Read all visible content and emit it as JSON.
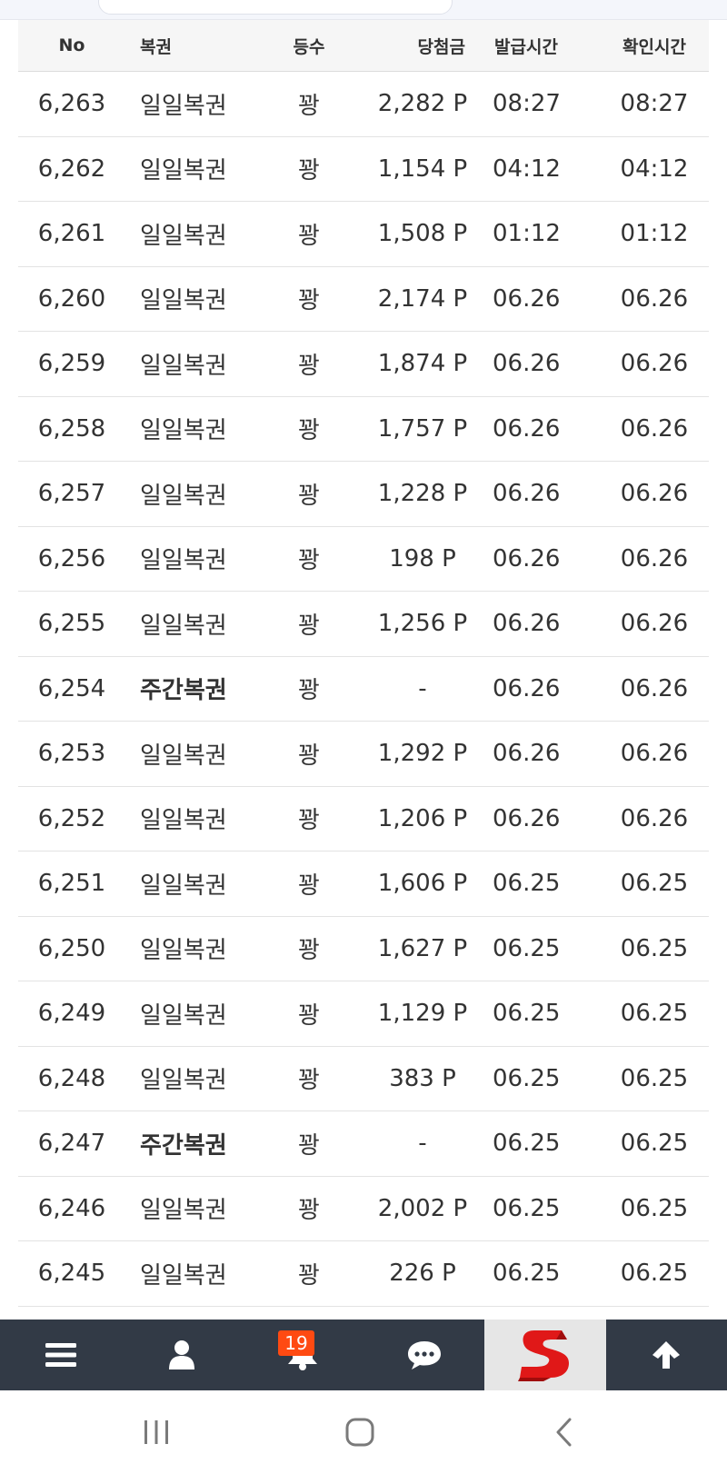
{
  "table": {
    "headers": {
      "no": "No",
      "type": "복권",
      "rank": "등수",
      "prize": "당첨금",
      "issued": "발급시간",
      "checked": "확인시간"
    },
    "rows": [
      {
        "no": "6,263",
        "type": "일일복권",
        "rank": "꽝",
        "prize": "2,282 P",
        "issued": "08:27",
        "checked": "08:27",
        "bold": false
      },
      {
        "no": "6,262",
        "type": "일일복권",
        "rank": "꽝",
        "prize": "1,154 P",
        "issued": "04:12",
        "checked": "04:12",
        "bold": false
      },
      {
        "no": "6,261",
        "type": "일일복권",
        "rank": "꽝",
        "prize": "1,508 P",
        "issued": "01:12",
        "checked": "01:12",
        "bold": false
      },
      {
        "no": "6,260",
        "type": "일일복권",
        "rank": "꽝",
        "prize": "2,174 P",
        "issued": "06.26",
        "checked": "06.26",
        "bold": false
      },
      {
        "no": "6,259",
        "type": "일일복권",
        "rank": "꽝",
        "prize": "1,874 P",
        "issued": "06.26",
        "checked": "06.26",
        "bold": false
      },
      {
        "no": "6,258",
        "type": "일일복권",
        "rank": "꽝",
        "prize": "1,757 P",
        "issued": "06.26",
        "checked": "06.26",
        "bold": false
      },
      {
        "no": "6,257",
        "type": "일일복권",
        "rank": "꽝",
        "prize": "1,228 P",
        "issued": "06.26",
        "checked": "06.26",
        "bold": false
      },
      {
        "no": "6,256",
        "type": "일일복권",
        "rank": "꽝",
        "prize": "198 P",
        "issued": "06.26",
        "checked": "06.26",
        "bold": false
      },
      {
        "no": "6,255",
        "type": "일일복권",
        "rank": "꽝",
        "prize": "1,256 P",
        "issued": "06.26",
        "checked": "06.26",
        "bold": false
      },
      {
        "no": "6,254",
        "type": "주간복권",
        "rank": "꽝",
        "prize": "-",
        "issued": "06.26",
        "checked": "06.26",
        "bold": true
      },
      {
        "no": "6,253",
        "type": "일일복권",
        "rank": "꽝",
        "prize": "1,292 P",
        "issued": "06.26",
        "checked": "06.26",
        "bold": false
      },
      {
        "no": "6,252",
        "type": "일일복권",
        "rank": "꽝",
        "prize": "1,206 P",
        "issued": "06.26",
        "checked": "06.26",
        "bold": false
      },
      {
        "no": "6,251",
        "type": "일일복권",
        "rank": "꽝",
        "prize": "1,606 P",
        "issued": "06.25",
        "checked": "06.25",
        "bold": false
      },
      {
        "no": "6,250",
        "type": "일일복권",
        "rank": "꽝",
        "prize": "1,627 P",
        "issued": "06.25",
        "checked": "06.25",
        "bold": false
      },
      {
        "no": "6,249",
        "type": "일일복권",
        "rank": "꽝",
        "prize": "1,129 P",
        "issued": "06.25",
        "checked": "06.25",
        "bold": false
      },
      {
        "no": "6,248",
        "type": "일일복권",
        "rank": "꽝",
        "prize": "383 P",
        "issued": "06.25",
        "checked": "06.25",
        "bold": false
      },
      {
        "no": "6,247",
        "type": "주간복권",
        "rank": "꽝",
        "prize": "-",
        "issued": "06.25",
        "checked": "06.25",
        "bold": true
      },
      {
        "no": "6,246",
        "type": "일일복권",
        "rank": "꽝",
        "prize": "2,002 P",
        "issued": "06.25",
        "checked": "06.25",
        "bold": false
      },
      {
        "no": "6,245",
        "type": "일일복권",
        "rank": "꽝",
        "prize": "226 P",
        "issued": "06.25",
        "checked": "06.25",
        "bold": false
      }
    ]
  },
  "bottom_nav": {
    "items": [
      {
        "icon": "menu-icon"
      },
      {
        "icon": "user-icon"
      },
      {
        "icon": "bell-icon"
      },
      {
        "icon": "chat-icon"
      },
      {
        "icon": "site-logo"
      },
      {
        "icon": "arrow-up-icon"
      }
    ],
    "notification_count": "19",
    "colors": {
      "bar": "#323a46",
      "badge": "#ff4a12",
      "logo_red": "#e01818"
    }
  },
  "system_nav": {
    "items": [
      {
        "icon": "recent-apps-icon"
      },
      {
        "icon": "home-icon"
      },
      {
        "icon": "back-icon"
      }
    ]
  }
}
